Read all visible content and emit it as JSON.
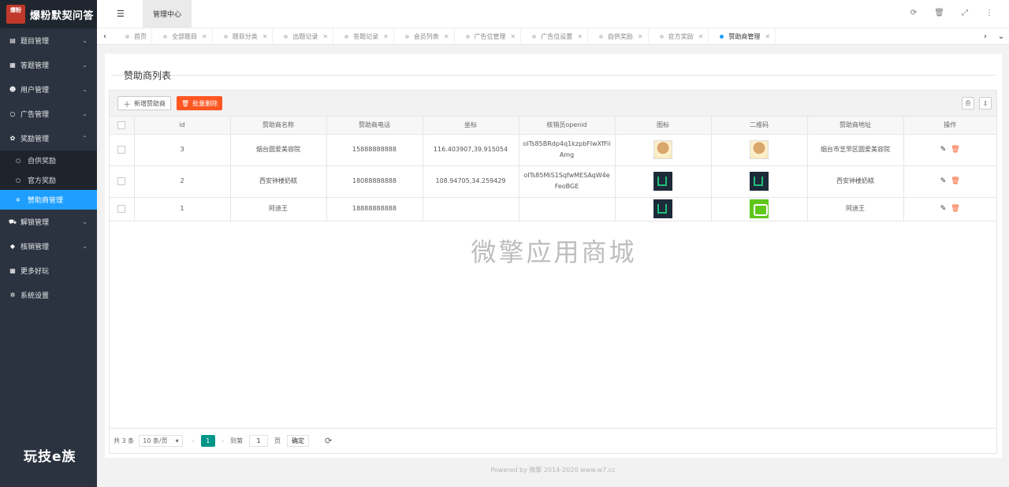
{
  "logo": {
    "badge": "爆粉",
    "title": "爆粉默契问答"
  },
  "sidebar": {
    "items": [
      {
        "icon": "book-icon",
        "glyph": "▤",
        "label": "题目管理"
      },
      {
        "icon": "calendar-icon",
        "glyph": "▦",
        "label": "答题管理"
      },
      {
        "icon": "users-icon",
        "glyph": "☻",
        "label": "用户管理"
      },
      {
        "icon": "circle-icon",
        "glyph": "○",
        "label": "广告管理"
      },
      {
        "icon": "gift-icon",
        "glyph": "✿",
        "label": "奖励管理"
      }
    ],
    "sub_items": [
      {
        "label": "自供奖励",
        "active": false
      },
      {
        "label": "官方奖励",
        "active": false
      },
      {
        "label": "赞助商管理",
        "active": true
      }
    ],
    "items_after": [
      {
        "icon": "cart-icon",
        "glyph": "⛟",
        "label": "解锁管理"
      },
      {
        "icon": "tag-icon",
        "glyph": "◆",
        "label": "核销管理"
      },
      {
        "icon": "grid-icon",
        "glyph": "▦",
        "label": "更多好玩"
      },
      {
        "icon": "gear-icon",
        "glyph": "✲",
        "label": "系统设置"
      }
    ],
    "brand": "玩技e族"
  },
  "topbar": {
    "active_tab": "管理中心"
  },
  "tabs": [
    {
      "label": "首页",
      "closable": false,
      "active": false
    },
    {
      "label": "全部题目",
      "closable": true,
      "active": false
    },
    {
      "label": "题目分类",
      "closable": true,
      "active": false
    },
    {
      "label": "出题记录",
      "closable": true,
      "active": false
    },
    {
      "label": "答题记录",
      "closable": true,
      "active": false
    },
    {
      "label": "会员列表",
      "closable": true,
      "active": false
    },
    {
      "label": "广告位管理",
      "closable": true,
      "active": false
    },
    {
      "label": "广告位设置",
      "closable": true,
      "active": false
    },
    {
      "label": "自供奖励",
      "closable": true,
      "active": false
    },
    {
      "label": "官方奖励",
      "closable": true,
      "active": false
    },
    {
      "label": "赞助商管理",
      "closable": true,
      "active": true
    }
  ],
  "page": {
    "title": "赞助商列表",
    "add_button": "新增赞助商",
    "batch_delete_button": "批量删除",
    "watermark": "微擎应用商城"
  },
  "table": {
    "columns": [
      "id",
      "赞助商名称",
      "赞助商电话",
      "坐标",
      "核销员openid",
      "图标",
      "二维码",
      "赞助商地址",
      "操作"
    ],
    "rows": [
      {
        "id": "3",
        "name": "烟台圆爱美容院",
        "phone": "15888888888",
        "coord": "116.403907,39.915054",
        "openid": "oITs85BRdp4q1kzpbFIwXfFiiAmg",
        "icon": "portrait",
        "qrcode": "portrait",
        "address": "烟台市芝罘区圆爱美容院"
      },
      {
        "id": "2",
        "name": "西安钟楼奶糕",
        "phone": "18088888888",
        "coord": "108.94705,34.259429",
        "openid": "oITs85MiS1SqfwMESAqW4eFeoBGE",
        "icon": "dark",
        "qrcode": "dark",
        "address": "西安钟楼奶糕"
      },
      {
        "id": "1",
        "name": "阿迪王",
        "phone": "18888888888",
        "coord": "",
        "openid": "",
        "icon": "dark",
        "qrcode": "green",
        "address": "阿迪王"
      }
    ]
  },
  "pager": {
    "total": "共 3 条",
    "page_size": "10 条/页",
    "current": "1",
    "goto_label": "到第",
    "goto_value": "1",
    "page_unit": "页",
    "confirm": "确定"
  },
  "footer": "Powered by 微擎 2014-2020 www.w7.cc"
}
